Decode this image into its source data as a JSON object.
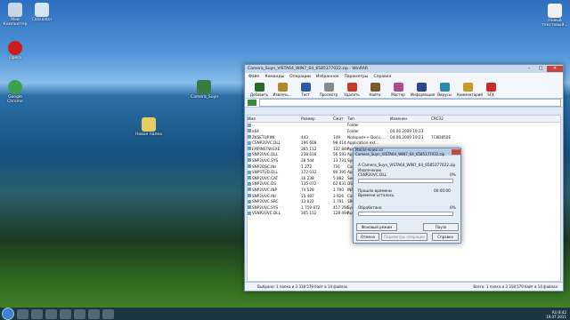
{
  "desktop_icons": [
    {
      "label": "Мой Компьютер",
      "color": "#c8d7e8"
    },
    {
      "label": "Calculator",
      "color": "#d6e4f3"
    },
    {
      "label": "Opera",
      "color": "#cc1c1c"
    },
    {
      "label": "Google Chrome",
      "color": "#3ea04a"
    },
    {
      "label": "Camera_Suyn",
      "color": "#3b7a43"
    },
    {
      "label": "Новая папка",
      "color": "#e6cc64"
    }
  ],
  "desktop_right_icons": [
    {
      "label": "Новый текстовый...",
      "color": "#f0f0f0"
    },
    {
      "label": "",
      "color": "#f0f0f0"
    }
  ],
  "window": {
    "title": "Camera_Suyn_VISTA64_WIN7_64_6585377022.zip - WinRAR",
    "menu": [
      "Файл",
      "Команды",
      "Операции",
      "Избранное",
      "Параметры",
      "Справка"
    ],
    "toolbar": [
      {
        "label": "Добавить",
        "color": "#2a6a2a"
      },
      {
        "label": "Извлечь...",
        "color": "#b08a2a"
      },
      {
        "label": "Тест",
        "color": "#2b5ca8"
      },
      {
        "label": "Просмотр",
        "color": "#8a8a8a"
      },
      {
        "label": "Удалить",
        "color": "#c83a2a"
      },
      {
        "label": "Найти",
        "color": "#7a5a2a"
      },
      {
        "label": "Мастер",
        "color": "#b04a8a"
      },
      {
        "label": "Информация",
        "color": "#2a4a8a"
      },
      {
        "label": "Вирусы",
        "color": "#2a8ab0"
      },
      {
        "label": "Комментарий",
        "color": "#c89a2a"
      },
      {
        "label": "SFX",
        "color": "#c82a2a"
      }
    ],
    "columns": [
      "Имя",
      "Размер",
      "Сжат",
      "Тип",
      "Изменен",
      "CRC32"
    ],
    "rows": [
      [
        "..",
        "",
        "",
        "Folder",
        "",
        ""
      ],
      [
        "x64",
        "",
        "",
        "Folder",
        "04.06.2009 19:23",
        ""
      ],
      [
        "ZKSETUP.INI",
        "443",
        "149",
        "Notepad++ Docu...",
        "04.06.2009 19:23",
        "7C8D850E"
      ],
      [
        "CSNP2UVC.DLL",
        "196 608",
        "98 414",
        "Application ext...",
        "",
        ""
      ],
      [
        "FMPINSTW.EXE",
        "365 112",
        "137 849",
        "Application",
        "",
        ""
      ],
      [
        "SNP2UVC.DLL",
        "238 616",
        "56 593",
        "Application ext...",
        "",
        ""
      ],
      [
        "SNP2UVC.SYS",
        "28 544",
        "13 731",
        "System file",
        "",
        ""
      ],
      [
        "SNP2DSC.INI",
        "1 272",
        "731",
        "Configuration...",
        "",
        ""
      ],
      [
        "SNPSTUD.DLL",
        "172 032",
        "80 395",
        "Application ext...",
        "",
        ""
      ],
      [
        "SNP2UVC.CAT",
        "16 238",
        "5 882",
        "Security Catal...",
        "",
        ""
      ],
      [
        "SNP2UVC.DS",
        "135 072",
        "62 831",
        "DS File",
        "",
        ""
      ],
      [
        "SNP2UVC.INP",
        "74 528",
        "1 790",
        "INP File",
        "",
        ""
      ],
      [
        "SNP2UVC.INI",
        "15 487",
        "3 926",
        "Configuration...",
        "",
        ""
      ],
      [
        "SNP2UVC.SRC",
        "13 022",
        "1 791",
        "SRC File",
        "",
        ""
      ],
      [
        "SNP2UVC.SYS",
        "1 759 872",
        "417 290",
        "System file",
        "",
        ""
      ],
      [
        "VSNP2UVC.DLL",
        "305 152",
        "128 494",
        "Application ext...",
        "",
        ""
      ]
    ],
    "status_left": "Выбрано: 1 папка и 3 318 579 байт в 14 файлах",
    "status_right": "Всего: 1 папка и 3 318 579 байт в 14 файлах"
  },
  "dialog": {
    "title": "Извлечение из Camera_Suyn_VISTA64_WIN7_64_6585377022.zip",
    "archive": "A  Camera_Suyn_VISTA64_WIN7_64_6585377022.zip",
    "action": "Извлечение",
    "file": "CSNP2UVC.DLL",
    "percent1": "0%",
    "elapsed_label": "Прошло времени",
    "remaining_label": "Времени осталось",
    "elapsed_value": "00:00:00",
    "processed_label": "Обработано",
    "percent2": "0%",
    "btn_background": "Фоновый режим",
    "btn_pause": "Пауза",
    "btn_cancel": "Отмена",
    "btn_params": "Параметры операции",
    "btn_help": "Справка"
  },
  "tray": {
    "lang": "RU",
    "time": "8:42",
    "date": "19.07.2011"
  }
}
